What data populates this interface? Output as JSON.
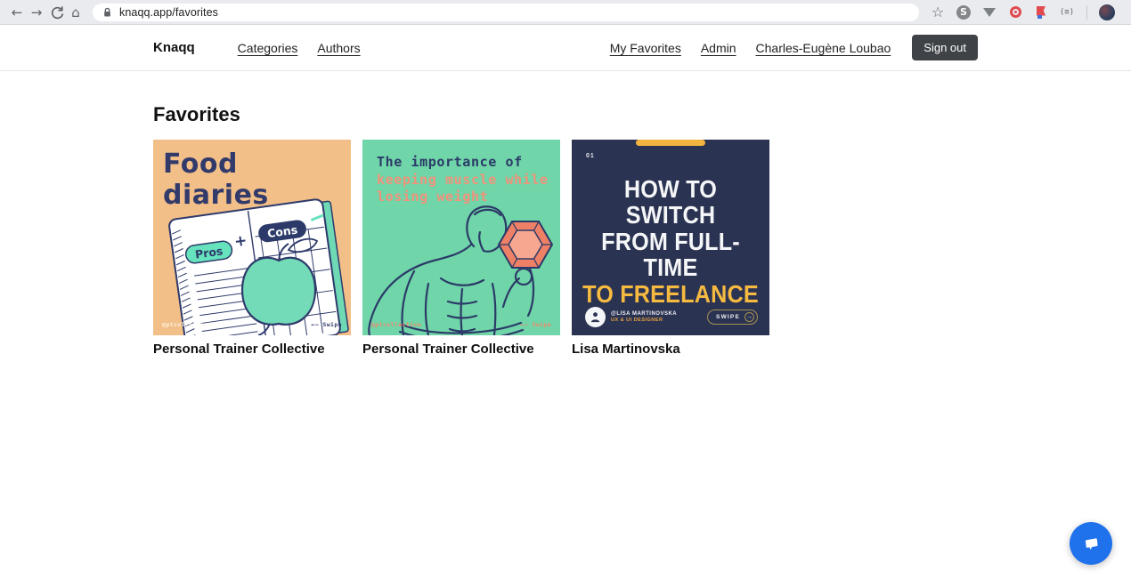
{
  "colors": {
    "toolbar_bg": "#e9ebef",
    "signout_bg": "#3f4347",
    "card1_bg": "#f3bf88",
    "card1_navy": "#323a6b",
    "card1_mint": "#66e2bd",
    "card2_bg": "#70d5a8",
    "card2_navy": "#2b3a68",
    "card2_salmon": "#f0937c",
    "card3_bg": "#2b3352",
    "card3_yellow": "#f6ba41",
    "chat_blue": "#1f72eb"
  },
  "browser": {
    "url": "knaqq.app/favorites",
    "icons": {
      "back": "←",
      "forward": "→",
      "home": "⌂",
      "star": "☆",
      "skype_letter": "S",
      "parens": "(≡)",
      "dots": "⋮"
    }
  },
  "header": {
    "logo": "Knaqq",
    "nav_left": [
      {
        "label": "Categories"
      },
      {
        "label": "Authors"
      }
    ],
    "nav_right": [
      {
        "label": "My Favorites"
      },
      {
        "label": "Admin"
      },
      {
        "label": "Charles-Eugène Loubao"
      }
    ],
    "signout_label": "Sign out"
  },
  "page": {
    "title": "Favorites",
    "cards": [
      {
        "title": "Food diaries",
        "pros_label": "Pros",
        "plus": "+",
        "cons_label": "Cons",
        "handle": "@ptcollective",
        "swipe_label": "←— Swipe",
        "author": "Personal Trainer Collective"
      },
      {
        "title_line1": "The importance of",
        "title_line2": "keeping muscle while",
        "title_line3": "losing weight",
        "handle": "@ptcollective",
        "swipe_label": "←— Swipe",
        "author": "Personal Trainer Collective"
      },
      {
        "page_number": "01",
        "title_line1": "HOW TO SWITCH",
        "title_line2": "FROM FULL-TIME",
        "title_line3": "TO FREELANCE",
        "profile_name": "@LISA MARTINOVSKA",
        "profile_role": "UX & UI DESIGNER",
        "swipe_label": "SWIPE",
        "swipe_arrow": "→",
        "author": "Lisa Martinovska"
      }
    ]
  }
}
